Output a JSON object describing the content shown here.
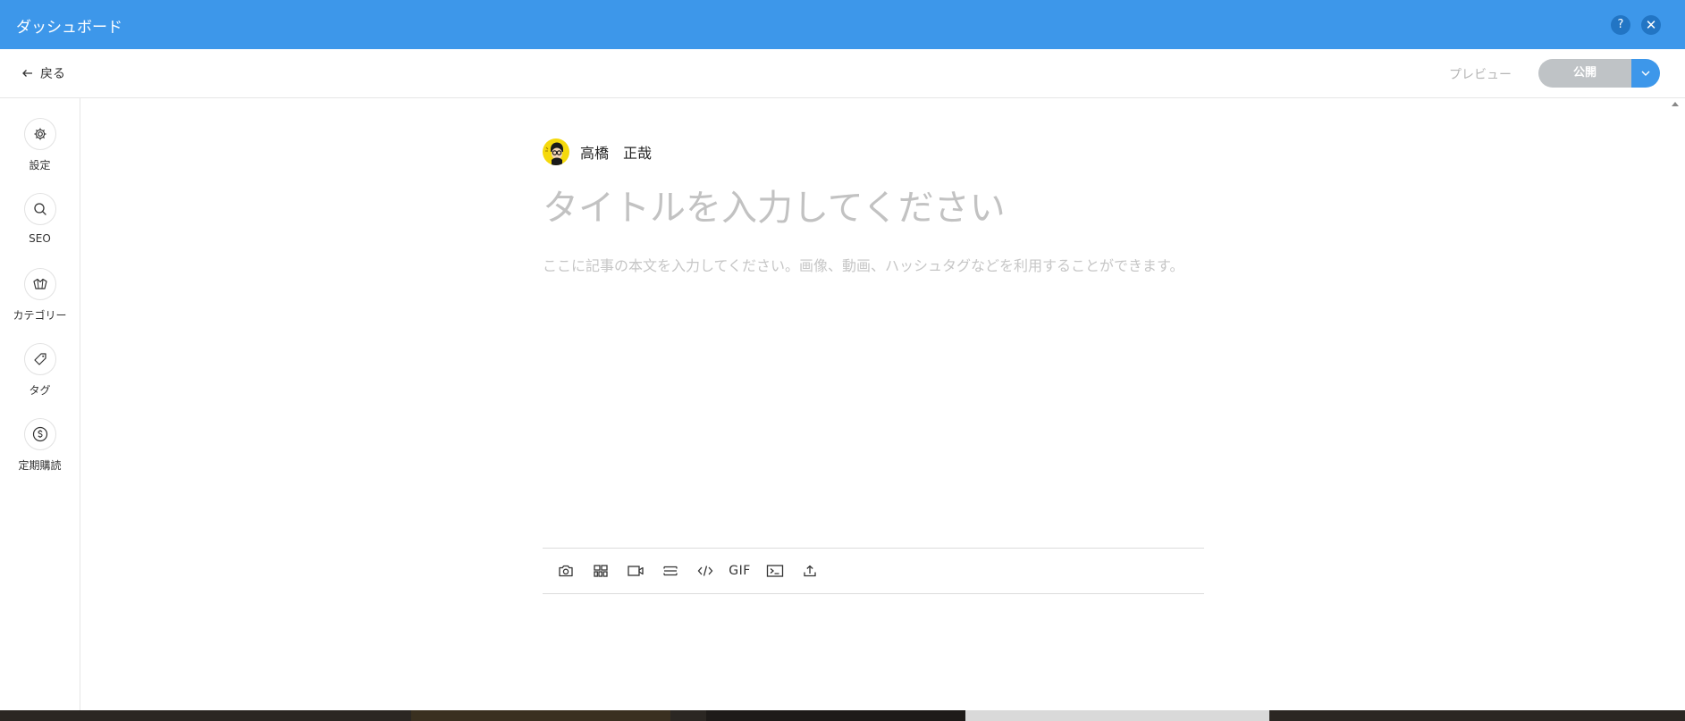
{
  "window": {
    "title": "ダッシュボード",
    "help_label": "?",
    "close_label": "✕"
  },
  "header": {
    "back_label": "戻る",
    "preview_label": "プレビュー",
    "publish_label": "公開"
  },
  "sidebar": {
    "items": [
      {
        "label": "設定",
        "icon": "gear-icon"
      },
      {
        "label": "SEO",
        "icon": "search-icon"
      },
      {
        "label": "カテゴリー",
        "icon": "category-icon"
      },
      {
        "label": "タグ",
        "icon": "tag-icon"
      },
      {
        "label": "定期購読",
        "icon": "dollar-icon"
      }
    ]
  },
  "editor": {
    "author_name": "高橋　正哉",
    "title_placeholder": "タイトルを入力してください",
    "body_placeholder": "ここに記事の本文を入力してください。画像、動画、ハッシュタグなどを利用することができます。"
  },
  "toolbar": {
    "gif_label": "GIF",
    "tools": [
      "camera-icon",
      "gallery-icon",
      "video-icon",
      "divider-icon",
      "embed-code-icon",
      "gif-icon",
      "terminal-icon",
      "upload-icon"
    ]
  }
}
